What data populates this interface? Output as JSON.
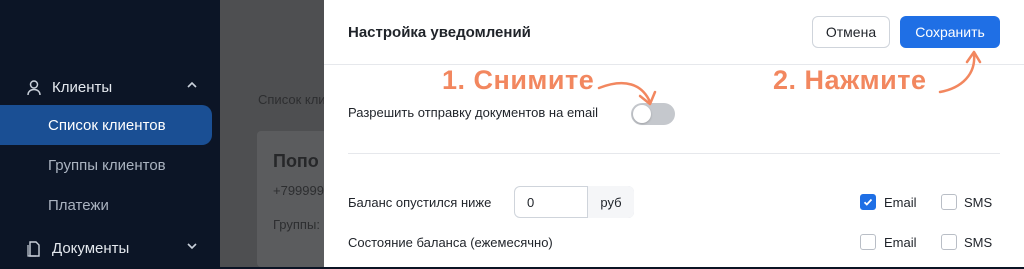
{
  "sidebar": {
    "sections": [
      {
        "label": "Клиенты",
        "icon": "user-icon",
        "expanded": true
      },
      {
        "label": "Документы",
        "icon": "document-icon",
        "expanded": false
      }
    ],
    "items": [
      {
        "label": "Список клиентов",
        "active": true
      },
      {
        "label": "Группы клиентов",
        "active": false
      },
      {
        "label": "Платежи",
        "active": false
      }
    ]
  },
  "background": {
    "breadcrumb": "Список кли",
    "card_title": "Попо",
    "card_phone": "+799999",
    "card_groups": "Группы:"
  },
  "panel": {
    "title": "Настройка уведомлений",
    "cancel_label": "Отмена",
    "save_label": "Сохранить",
    "email_docs_label": "Разрешить отправку документов на email",
    "email_docs_enabled": true,
    "balance_below_label": "Баланс опустился ниже",
    "balance_value": "0",
    "balance_unit": "руб",
    "balance_state_label": "Состояние баланса (ежемесячно)",
    "rows": [
      {
        "email_label": "Email",
        "email_checked": true,
        "sms_label": "SMS",
        "sms_checked": false
      },
      {
        "email_label": "Email",
        "email_checked": false,
        "sms_label": "SMS",
        "sms_checked": false
      }
    ]
  },
  "annotations": {
    "step1": "1. Снимите",
    "step2": "2. Нажмите",
    "color": "#f2875f"
  },
  "colors": {
    "accent": "#1f6fe5",
    "sidebar_active": "#1a4f94"
  }
}
